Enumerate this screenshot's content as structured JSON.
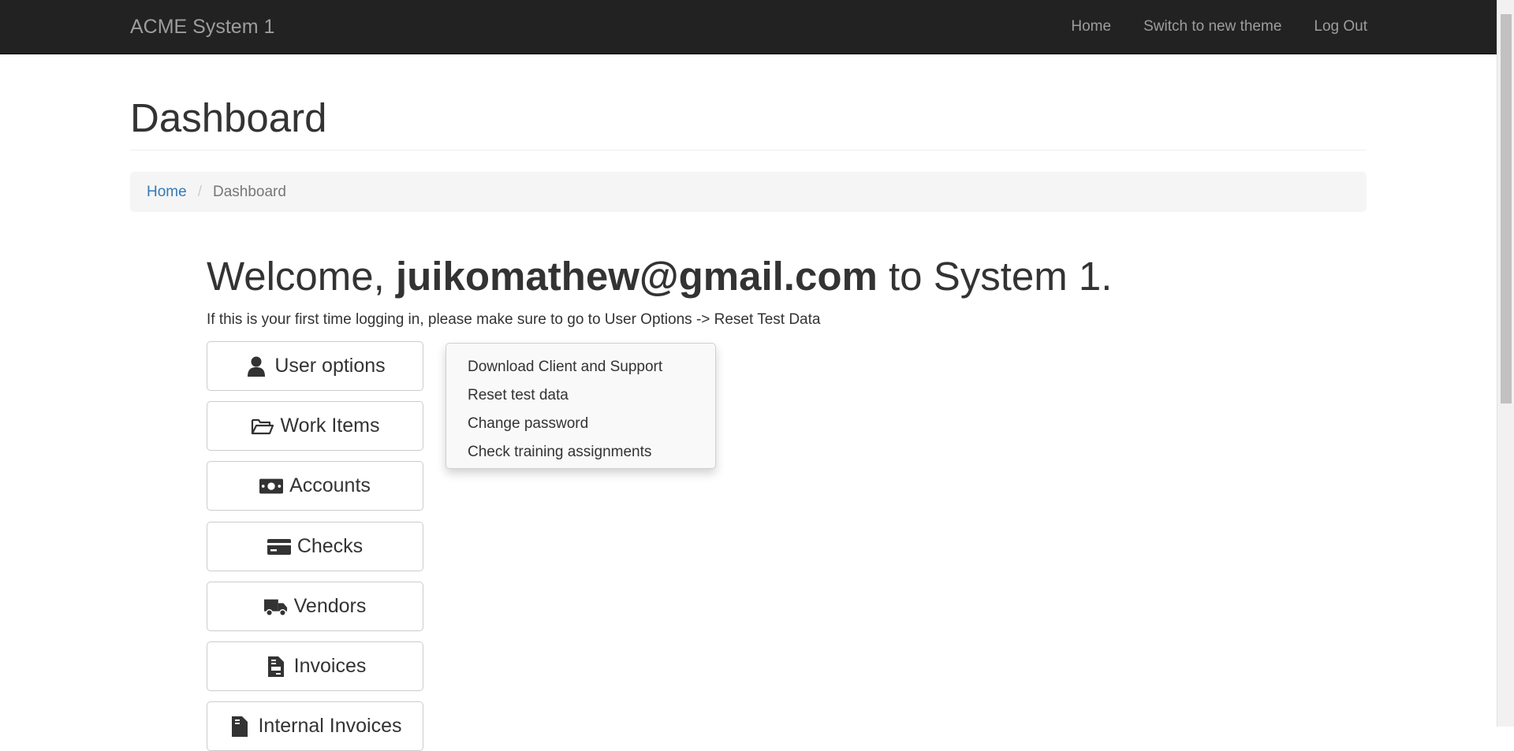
{
  "navbar": {
    "brand": "ACME System 1",
    "links": [
      "Home",
      "Switch to new theme",
      "Log Out"
    ]
  },
  "page": {
    "title": "Dashboard"
  },
  "breadcrumb": {
    "home": "Home",
    "separator": "/",
    "current": "Dashboard"
  },
  "welcome": {
    "prefix": "Welcome, ",
    "user": "juikomathew@gmail.com",
    "suffix": " to System 1.",
    "intro": "If this is your first time logging in, please make sure to go to User Options -> Reset Test Data"
  },
  "menu": {
    "items": [
      {
        "label": "User options",
        "icon": "user-icon"
      },
      {
        "label": "Work Items",
        "icon": "folder-open-icon"
      },
      {
        "label": "Accounts",
        "icon": "money-bill-icon"
      },
      {
        "label": "Checks",
        "icon": "credit-card-icon"
      },
      {
        "label": "Vendors",
        "icon": "truck-icon"
      },
      {
        "label": "Invoices",
        "icon": "file-invoice-icon"
      },
      {
        "label": "Internal Invoices",
        "icon": "file-invoice-dollar-icon"
      }
    ]
  },
  "dropdown": {
    "items": [
      "Download Client and Support",
      "Reset test data",
      "Change password",
      "Check training assignments"
    ]
  },
  "colors": {
    "navbar_bg": "#222222",
    "navbar_text": "#9d9d9d",
    "link": "#337ab7",
    "breadcrumb_bg": "#f5f5f5"
  }
}
